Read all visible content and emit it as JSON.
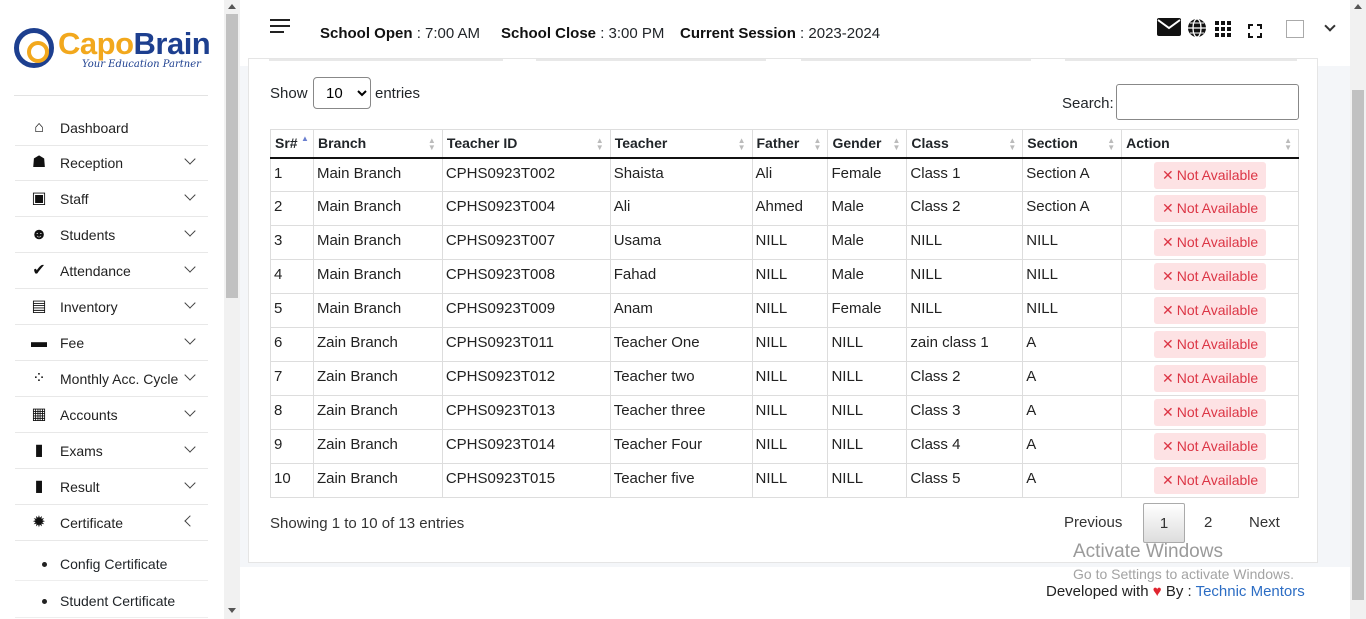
{
  "brand": {
    "name_part1": "Capo",
    "name_part2": "Brain",
    "tagline": "Your Education Partner"
  },
  "sidebar": {
    "items": [
      {
        "label": "Dashboard",
        "icon": "home-icon",
        "glyph": "⌂"
      },
      {
        "label": "Reception",
        "icon": "reception-icon",
        "glyph": "☗"
      },
      {
        "label": "Staff",
        "icon": "staff-icon",
        "glyph": "▣"
      },
      {
        "label": "Students",
        "icon": "graduation-cap-icon",
        "glyph": "☻"
      },
      {
        "label": "Attendance",
        "icon": "check-icon",
        "glyph": "✔"
      },
      {
        "label": "Inventory",
        "icon": "clipboard-list-icon",
        "glyph": "▤"
      },
      {
        "label": "Fee",
        "icon": "money-icon",
        "glyph": "▬"
      },
      {
        "label": "Monthly Acc. Cycle",
        "icon": "spinner-icon",
        "glyph": "⁘"
      },
      {
        "label": "Accounts",
        "icon": "calculator-icon",
        "glyph": "▦"
      },
      {
        "label": "Exams",
        "icon": "clipboard-icon",
        "glyph": "▮"
      },
      {
        "label": "Result",
        "icon": "clipboard-icon",
        "glyph": "▮"
      },
      {
        "label": "Certificate",
        "icon": "certificate-icon",
        "glyph": "✹"
      }
    ],
    "sub_items": [
      {
        "label": "Config Certificate"
      },
      {
        "label": "Student Certificate"
      }
    ]
  },
  "header": {
    "school_open_label": "School Open",
    "school_open_value": ": 7:00 AM",
    "school_close_label": "School Close",
    "school_close_value": ": 3:00 PM",
    "session_label": "Current Session",
    "session_value": ": 2023-2024",
    "icons": [
      "envelope-icon",
      "globe-icon",
      "grid-icon",
      "fullscreen-icon",
      "avatar",
      "chevron-down-icon"
    ]
  },
  "table_controls": {
    "show_label": "Show",
    "entries_label": "entries",
    "page_size": "10",
    "page_size_options": [
      "10"
    ],
    "search_label": "Search:",
    "search_value": ""
  },
  "table": {
    "columns": [
      "Sr#",
      "Branch",
      "Teacher ID",
      "Teacher",
      "Father",
      "Gender",
      "Class",
      "Section",
      "Action"
    ],
    "rows": [
      [
        "1",
        "Main Branch",
        "CPHS0923T002",
        "Shaista",
        "Ali",
        "Female",
        "Class 1",
        "Section A",
        "Not Available"
      ],
      [
        "2",
        "Main Branch",
        "CPHS0923T004",
        "Ali",
        "Ahmed",
        "Male",
        "Class 2",
        "Section A",
        "Not Available"
      ],
      [
        "3",
        "Main Branch",
        "CPHS0923T007",
        "Usama",
        "NILL",
        "Male",
        "NILL",
        "NILL",
        "Not Available"
      ],
      [
        "4",
        "Main Branch",
        "CPHS0923T008",
        "Fahad",
        "NILL",
        "Male",
        "NILL",
        "NILL",
        "Not Available"
      ],
      [
        "5",
        "Main Branch",
        "CPHS0923T009",
        "Anam",
        "NILL",
        "Female",
        "NILL",
        "NILL",
        "Not Available"
      ],
      [
        "6",
        "Zain Branch",
        "CPHS0923T011",
        "Teacher One",
        "NILL",
        "NILL",
        "zain class 1",
        "A",
        "Not Available"
      ],
      [
        "7",
        "Zain Branch",
        "CPHS0923T012",
        "Teacher two",
        "NILL",
        "NILL",
        "Class 2",
        "A",
        "Not Available"
      ],
      [
        "8",
        "Zain Branch",
        "CPHS0923T013",
        "Teacher three",
        "NILL",
        "NILL",
        "Class 3",
        "A",
        "Not Available"
      ],
      [
        "9",
        "Zain Branch",
        "CPHS0923T014",
        "Teacher Four",
        "NILL",
        "NILL",
        "Class 4",
        "A",
        "Not Available"
      ],
      [
        "10",
        "Zain Branch",
        "CPHS0923T015",
        "Teacher five",
        "NILL",
        "NILL",
        "Class 5",
        "A",
        "Not Available"
      ]
    ]
  },
  "pagination": {
    "info": "Showing 1 to 10 of 13 entries",
    "previous": "Previous",
    "pages": [
      "1",
      "2"
    ],
    "current": "1",
    "next": "Next"
  },
  "watermark": {
    "line1": "Activate Windows",
    "line2": "Go to Settings to activate Windows."
  },
  "footer": {
    "prefix": "Developed with",
    "by": "By :",
    "link": "Technic Mentors"
  },
  "colors": {
    "brand_orange": "#f2a81d",
    "brand_blue": "#1d3f8f",
    "danger": "#dc3545",
    "danger_bg": "#fde2e4",
    "link": "#2c6dc4"
  }
}
